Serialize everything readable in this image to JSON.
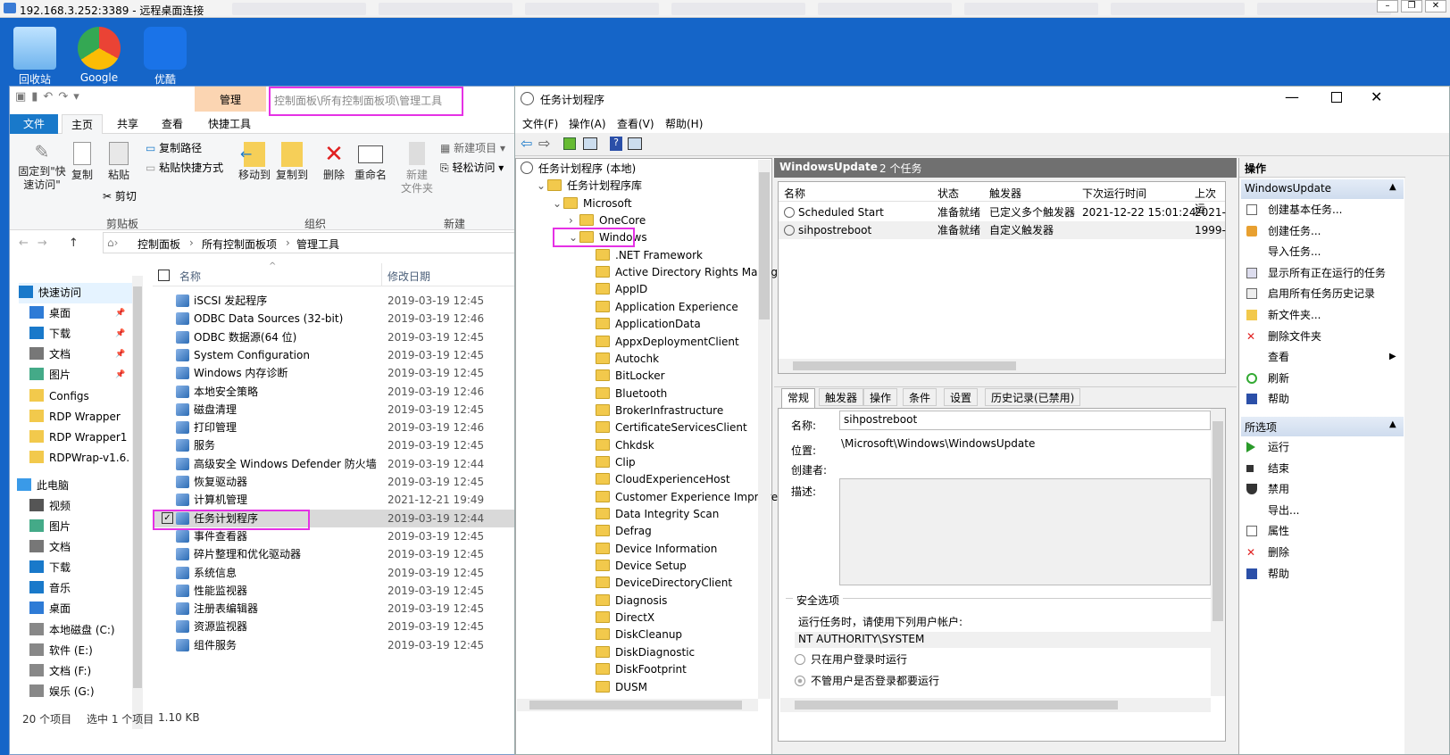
{
  "rdp": {
    "title": "192.168.3.252:3389 - 远程桌面连接"
  },
  "desktop": {
    "icons": [
      {
        "label": "回收站",
        "name": "recycle-bin-icon"
      },
      {
        "label": "Google",
        "name": "chrome-icon"
      },
      {
        "label": "优酷",
        "name": "youku-icon"
      }
    ]
  },
  "explorer": {
    "manage_tab": "管理",
    "address_overlay": "控制面板\\所有控制面板项\\管理工具",
    "tabs": [
      "文件",
      "主页",
      "共享",
      "查看",
      "快捷工具"
    ],
    "ribbon": {
      "pin": "固定到\"快\n速访问\"",
      "copy": "复制",
      "paste": "粘贴",
      "copy_path": "复制路径",
      "paste_shortcut": "粘贴快捷方式",
      "cut": "剪切",
      "move_to": "移动到",
      "copy_to": "复制到",
      "delete": "删除",
      "rename": "重命名",
      "new_folder": "新建\n文件夹",
      "new_item": "新建项目",
      "easy_access": "轻松访问",
      "groups": [
        "剪贴板",
        "组织",
        "新建"
      ]
    },
    "breadcrumb": [
      "控制面板",
      "所有控制面板项",
      "管理工具"
    ],
    "nav": [
      {
        "label": "快速访问",
        "pin": false
      },
      {
        "label": "桌面",
        "pin": true
      },
      {
        "label": "下载",
        "pin": true
      },
      {
        "label": "文档",
        "pin": true
      },
      {
        "label": "图片",
        "pin": true
      },
      {
        "label": "Configs",
        "pin": false
      },
      {
        "label": "RDP Wrapper",
        "pin": false
      },
      {
        "label": "RDP Wrapper1",
        "pin": false
      },
      {
        "label": "RDPWrap-v1.6.",
        "pin": false
      },
      {
        "label": "此电脑",
        "pin": false
      },
      {
        "label": "视频",
        "pin": false
      },
      {
        "label": "图片",
        "pin": false
      },
      {
        "label": "文档",
        "pin": false
      },
      {
        "label": "下载",
        "pin": false
      },
      {
        "label": "音乐",
        "pin": false
      },
      {
        "label": "桌面",
        "pin": false
      },
      {
        "label": "本地磁盘 (C:)",
        "pin": false
      },
      {
        "label": "软件 (E:)",
        "pin": false
      },
      {
        "label": "文档 (F:)",
        "pin": false
      },
      {
        "label": "娱乐 (G:)",
        "pin": false
      }
    ],
    "columns": {
      "name": "名称",
      "date": "修改日期"
    },
    "files": [
      {
        "name": "iSCSI 发起程序",
        "date": "2019-03-19 12:45"
      },
      {
        "name": "ODBC Data Sources (32-bit)",
        "date": "2019-03-19 12:46"
      },
      {
        "name": "ODBC 数据源(64 位)",
        "date": "2019-03-19 12:45"
      },
      {
        "name": "System Configuration",
        "date": "2019-03-19 12:45"
      },
      {
        "name": "Windows 内存诊断",
        "date": "2019-03-19 12:45"
      },
      {
        "name": "本地安全策略",
        "date": "2019-03-19 12:46"
      },
      {
        "name": "磁盘清理",
        "date": "2019-03-19 12:45"
      },
      {
        "name": "打印管理",
        "date": "2019-03-19 12:46"
      },
      {
        "name": "服务",
        "date": "2019-03-19 12:45"
      },
      {
        "name": "高级安全 Windows Defender 防火墙",
        "date": "2019-03-19 12:44"
      },
      {
        "name": "恢复驱动器",
        "date": "2019-03-19 12:45"
      },
      {
        "name": "计算机管理",
        "date": "2021-12-21 19:49"
      },
      {
        "name": "任务计划程序",
        "date": "2019-03-19 12:44"
      },
      {
        "name": "事件查看器",
        "date": "2019-03-19 12:45"
      },
      {
        "name": "碎片整理和优化驱动器",
        "date": "2019-03-19 12:45"
      },
      {
        "name": "系统信息",
        "date": "2019-03-19 12:45"
      },
      {
        "name": "性能监视器",
        "date": "2019-03-19 12:45"
      },
      {
        "name": "注册表编辑器",
        "date": "2019-03-19 12:45"
      },
      {
        "name": "资源监视器",
        "date": "2019-03-19 12:45"
      },
      {
        "name": "组件服务",
        "date": "2019-03-19 12:45"
      }
    ],
    "status": {
      "count": "20 个项目",
      "selected": "选中 1 个项目",
      "size": "1.10 KB"
    }
  },
  "ts": {
    "title": "任务计划程序",
    "menu": [
      "文件(F)",
      "操作(A)",
      "查看(V)",
      "帮助(H)"
    ],
    "tree": [
      {
        "label": "任务计划程序 (本地)",
        "depth": 0,
        "arrow": ""
      },
      {
        "label": "任务计划程序库",
        "depth": 1,
        "arrow": "v"
      },
      {
        "label": "Microsoft",
        "depth": 2,
        "arrow": "v"
      },
      {
        "label": "OneCore",
        "depth": 3,
        "arrow": ">"
      },
      {
        "label": "Windows",
        "depth": 3,
        "arrow": "v"
      },
      {
        "label": ".NET Framework",
        "depth": 4,
        "arrow": ""
      },
      {
        "label": "Active Directory Rights Manage",
        "depth": 4,
        "arrow": ""
      },
      {
        "label": "AppID",
        "depth": 4,
        "arrow": ""
      },
      {
        "label": "Application Experience",
        "depth": 4,
        "arrow": ""
      },
      {
        "label": "ApplicationData",
        "depth": 4,
        "arrow": ""
      },
      {
        "label": "AppxDeploymentClient",
        "depth": 4,
        "arrow": ""
      },
      {
        "label": "Autochk",
        "depth": 4,
        "arrow": ""
      },
      {
        "label": "BitLocker",
        "depth": 4,
        "arrow": ""
      },
      {
        "label": "Bluetooth",
        "depth": 4,
        "arrow": ""
      },
      {
        "label": "BrokerInfrastructure",
        "depth": 4,
        "arrow": ""
      },
      {
        "label": "CertificateServicesClient",
        "depth": 4,
        "arrow": ""
      },
      {
        "label": "Chkdsk",
        "depth": 4,
        "arrow": ""
      },
      {
        "label": "Clip",
        "depth": 4,
        "arrow": ""
      },
      {
        "label": "CloudExperienceHost",
        "depth": 4,
        "arrow": ""
      },
      {
        "label": "Customer Experience Improvem",
        "depth": 4,
        "arrow": ""
      },
      {
        "label": "Data Integrity Scan",
        "depth": 4,
        "arrow": ""
      },
      {
        "label": "Defrag",
        "depth": 4,
        "arrow": ""
      },
      {
        "label": "Device Information",
        "depth": 4,
        "arrow": ""
      },
      {
        "label": "Device Setup",
        "depth": 4,
        "arrow": ""
      },
      {
        "label": "DeviceDirectoryClient",
        "depth": 4,
        "arrow": ""
      },
      {
        "label": "Diagnosis",
        "depth": 4,
        "arrow": ""
      },
      {
        "label": "DirectX",
        "depth": 4,
        "arrow": ""
      },
      {
        "label": "DiskCleanup",
        "depth": 4,
        "arrow": ""
      },
      {
        "label": "DiskDiagnostic",
        "depth": 4,
        "arrow": ""
      },
      {
        "label": "DiskFootprint",
        "depth": 4,
        "arrow": ""
      },
      {
        "label": "DUSM",
        "depth": 4,
        "arrow": ""
      }
    ],
    "header": {
      "folder": "WindowsUpdate",
      "count": "2 个任务"
    },
    "columns": [
      "名称",
      "状态",
      "触发器",
      "下次运行时间",
      "上次运"
    ],
    "tasks": [
      {
        "name": "Scheduled Start",
        "status": "准备就绪",
        "trigger": "已定义多个触发器",
        "next": "2021-12-22 15:01:24",
        "last": "2021-"
      },
      {
        "name": "sihpostreboot",
        "status": "准备就绪",
        "trigger": "自定义触发器",
        "next": "",
        "last": "1999-"
      }
    ],
    "detail_tabs": [
      "常规",
      "触发器",
      "操作",
      "条件",
      "设置",
      "历史记录(已禁用)"
    ],
    "detail": {
      "name_label": "名称:",
      "name": "sihpostreboot",
      "location_label": "位置:",
      "location": "\\Microsoft\\Windows\\WindowsUpdate",
      "author_label": "创建者:",
      "desc_label": "描述:",
      "security_title": "安全选项",
      "run_as_label": "运行任务时，请使用下列用户帐户:",
      "account": "NT AUTHORITY\\SYSTEM",
      "opt1": "只在用户登录时运行",
      "opt2": "不管用户是否登录都要运行"
    },
    "actions_title": "操作",
    "actions_section1": "WindowsUpdate",
    "actions1": [
      {
        "label": "创建基本任务...",
        "icon": "create-basic-task-icon"
      },
      {
        "label": "创建任务...",
        "icon": "create-task-icon"
      },
      {
        "label": "导入任务...",
        "icon": ""
      },
      {
        "label": "显示所有正在运行的任务",
        "icon": "running-tasks-icon"
      },
      {
        "label": "启用所有任务历史记录",
        "icon": "history-icon"
      },
      {
        "label": "新文件夹...",
        "icon": "new-folder-icon"
      },
      {
        "label": "删除文件夹",
        "icon": "delete-icon"
      },
      {
        "label": "查看",
        "icon": ""
      },
      {
        "label": "刷新",
        "icon": "refresh-icon"
      },
      {
        "label": "帮助",
        "icon": "help-icon"
      }
    ],
    "actions_section2": "所选项",
    "actions2": [
      {
        "label": "运行",
        "icon": "run-icon"
      },
      {
        "label": "结束",
        "icon": "end-icon"
      },
      {
        "label": "禁用",
        "icon": "disable-icon"
      },
      {
        "label": "导出...",
        "icon": ""
      },
      {
        "label": "属性",
        "icon": "properties-icon"
      },
      {
        "label": "删除",
        "icon": "delete-icon"
      },
      {
        "label": "帮助",
        "icon": "help-icon"
      }
    ]
  },
  "colors": {
    "highlight": "#e531e5",
    "ribbon_blue": "#1979ca",
    "header_gray": "#707070",
    "selection": "#cce8ff"
  }
}
